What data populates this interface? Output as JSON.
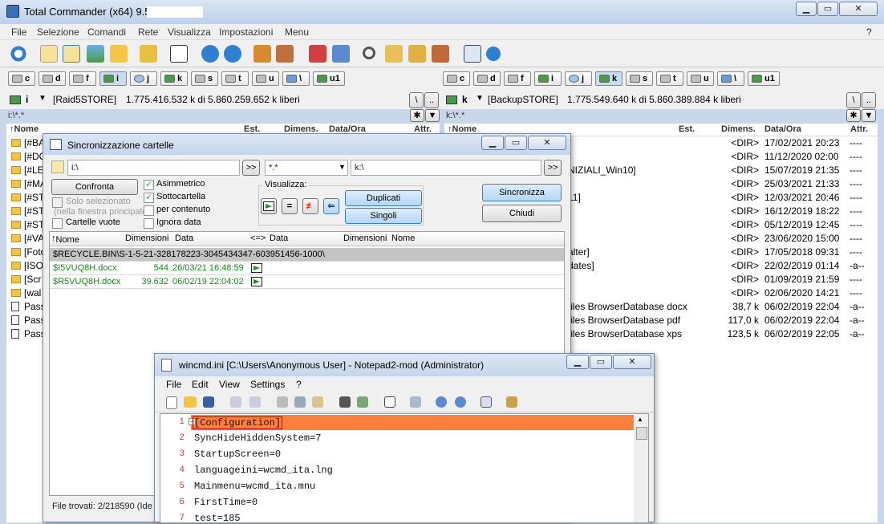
{
  "window": {
    "title": "Total Commander (x64) 9.51 -"
  },
  "menu": [
    "File",
    "Selezione",
    "Comandi",
    "Rete",
    "Visualizza",
    "Impostazioni",
    "Menu"
  ],
  "menu_help": "?",
  "drives": [
    "c",
    "d",
    "f",
    "i",
    "j",
    "k",
    "s",
    "t",
    "u",
    "\\",
    "u1"
  ],
  "left": {
    "drive": "i",
    "label": "[Raid5STORE]",
    "free": "1.775.416.532 k di 5.860.259.652 k liberi",
    "path": "i:\\*.*",
    "files": [
      {
        "name": "[#BA",
        "type": "dir"
      },
      {
        "name": "[#DO",
        "type": "dir"
      },
      {
        "name": "[#LE",
        "type": "dir"
      },
      {
        "name": "[#MA",
        "type": "dir"
      },
      {
        "name": "[#ST",
        "type": "dir"
      },
      {
        "name": "[#ST",
        "type": "dir"
      },
      {
        "name": "[#ST",
        "type": "dir"
      },
      {
        "name": "[#VA",
        "type": "dir"
      },
      {
        "name": "[Foto",
        "type": "dir"
      },
      {
        "name": "[ISO",
        "type": "dir"
      },
      {
        "name": "[Scr",
        "type": "dir"
      },
      {
        "name": "[wal",
        "type": "dir"
      },
      {
        "name": "Pass",
        "type": "doc"
      },
      {
        "name": "Pass",
        "type": "pdf"
      },
      {
        "name": "Pass",
        "type": "xps"
      }
    ]
  },
  "right": {
    "drive": "k",
    "label": "[BackupSTORE]",
    "free": "1.775.549.640 k di 5.860.389.884 k liberi",
    "path": "k:\\*.*",
    "files": [
      {
        "name": "",
        "size": "<DIR>",
        "date": "17/02/2021 20:23",
        "attr": "----"
      },
      {
        "name": "",
        "size": "<DIR>",
        "date": "11/12/2020 02:00",
        "attr": "----"
      },
      {
        "name": "NIZIALI_Win10]",
        "size": "<DIR>",
        "date": "15/07/2019 21:35",
        "attr": "----"
      },
      {
        "name": "",
        "size": "<DIR>",
        "date": "25/03/2021 21:33",
        "attr": "----"
      },
      {
        "name": "11]",
        "size": "<DIR>",
        "date": "12/03/2021 20:46",
        "attr": "----"
      },
      {
        "name": "]",
        "size": "<DIR>",
        "date": "16/12/2019 18:22",
        "attr": "----"
      },
      {
        "name": "",
        "size": "<DIR>",
        "date": "05/12/2019 12:45",
        "attr": "----"
      },
      {
        "name": "",
        "size": "<DIR>",
        "date": "23/06/2020 15:00",
        "attr": "----"
      },
      {
        "name": "alter]",
        "size": "<DIR>",
        "date": "17/05/2018 09:31",
        "attr": "----"
      },
      {
        "name": "dates]",
        "size": "<DIR>",
        "date": "22/02/2019 01:14",
        "attr": "-a--"
      },
      {
        "name": "",
        "size": "<DIR>",
        "date": "01/09/2019 21:59",
        "attr": "----"
      },
      {
        "name": "",
        "size": "<DIR>",
        "date": "02/06/2020 14:21",
        "attr": "----"
      },
      {
        "name": "files BrowserDatabase docx",
        "size": "38,7 k",
        "date": "06/02/2019 22:04",
        "attr": "-a--"
      },
      {
        "name": "files BrowserDatabase pdf",
        "size": "117,0 k",
        "date": "06/02/2019 22:04",
        "attr": "-a--"
      },
      {
        "name": "files BrowserDatabase xps",
        "size": "123,5 k",
        "date": "06/02/2019 22:05",
        "attr": "-a--"
      }
    ]
  },
  "columns": {
    "name": "Nome",
    "ext": "Est.",
    "size": "Dimens.",
    "date": "Data/Ora",
    "attr": "Attr."
  },
  "sync": {
    "title": "Sincronizzazione cartelle",
    "left_path": "i:\\",
    "mask": "*.*",
    "right_path": "k:\\",
    "browse": ">>",
    "compare": "Confronta",
    "only_selected": "Solo selezionato",
    "only_selected_sub": "(nella finestra principale",
    "empty_folders": "Cartelle vuote",
    "asymmetric": "Asimmetrico",
    "subfolder": "Sottocartella",
    "by_content": "per contenuto",
    "ignore_date": "Ignora data",
    "view_label": "Visualizza:",
    "duplicates": "Duplicati",
    "singles": "Singoli",
    "synchronize": "Sincronizza",
    "close": "Chiudi",
    "headers": {
      "name": "Nome",
      "size": "Dimensioni",
      "date": "Data",
      "cmp": "<=>",
      "date2": "Data",
      "size2": "Dimensioni",
      "name2": "Nome"
    },
    "group": "$RECYCLE.BIN\\S-1-5-21-328178223-3045434347-603951456-1000\\",
    "rows": [
      {
        "name": "$I5VUQ8H.docx",
        "size": "544",
        "date": "26/03/21 16:48:59"
      },
      {
        "name": "$R5VUQ8H.docx",
        "size": "39.632",
        "date": "06/02/19 22:04:02"
      }
    ],
    "status": "File trovati: 2/218590  (Ide"
  },
  "notepad": {
    "title": "wincmd.ini [C:\\Users\\Anonymous User] - Notepad2-mod (Administrator)",
    "menu": [
      "File",
      "Edit",
      "View",
      "Settings",
      "?"
    ],
    "lines": [
      "[Configuration]",
      "SyncHideHiddenSystem=7",
      "StartupScreen=0",
      "languageini=wcmd_ita.lng",
      "Mainmenu=wcmd_ita.mnu",
      "FirstTime=0",
      "test=185"
    ]
  }
}
